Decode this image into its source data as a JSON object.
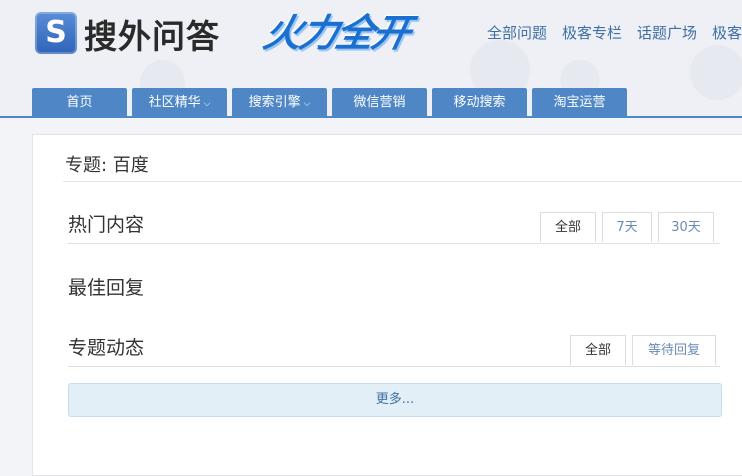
{
  "site": {
    "logo_letter": "S",
    "logo_text": "搜外问答",
    "banner_text": "火力全开"
  },
  "topnav": [
    "全部问题",
    "极客专栏",
    "话题广场",
    "极客"
  ],
  "mainnav": [
    {
      "label": "首页",
      "dropdown": false
    },
    {
      "label": "社区精华",
      "dropdown": true
    },
    {
      "label": "搜索引擎",
      "dropdown": true
    },
    {
      "label": "微信营销",
      "dropdown": false
    },
    {
      "label": "移动搜索",
      "dropdown": false
    },
    {
      "label": "淘宝运营",
      "dropdown": false
    }
  ],
  "page": {
    "title": "专题: 百度"
  },
  "sections": {
    "hot": {
      "title": "热门内容",
      "filters": [
        "全部",
        "7天",
        "30天"
      ],
      "active": "全部"
    },
    "best": {
      "title": "最佳回复"
    },
    "activity": {
      "title": "专题动态",
      "filters": [
        "全部",
        "等待回复"
      ],
      "active": "全部"
    }
  },
  "more_label": "更多...",
  "colors": {
    "nav_blue": "#4f86c6",
    "link_blue": "#3e6fa5",
    "more_bg": "#e2eff7"
  }
}
